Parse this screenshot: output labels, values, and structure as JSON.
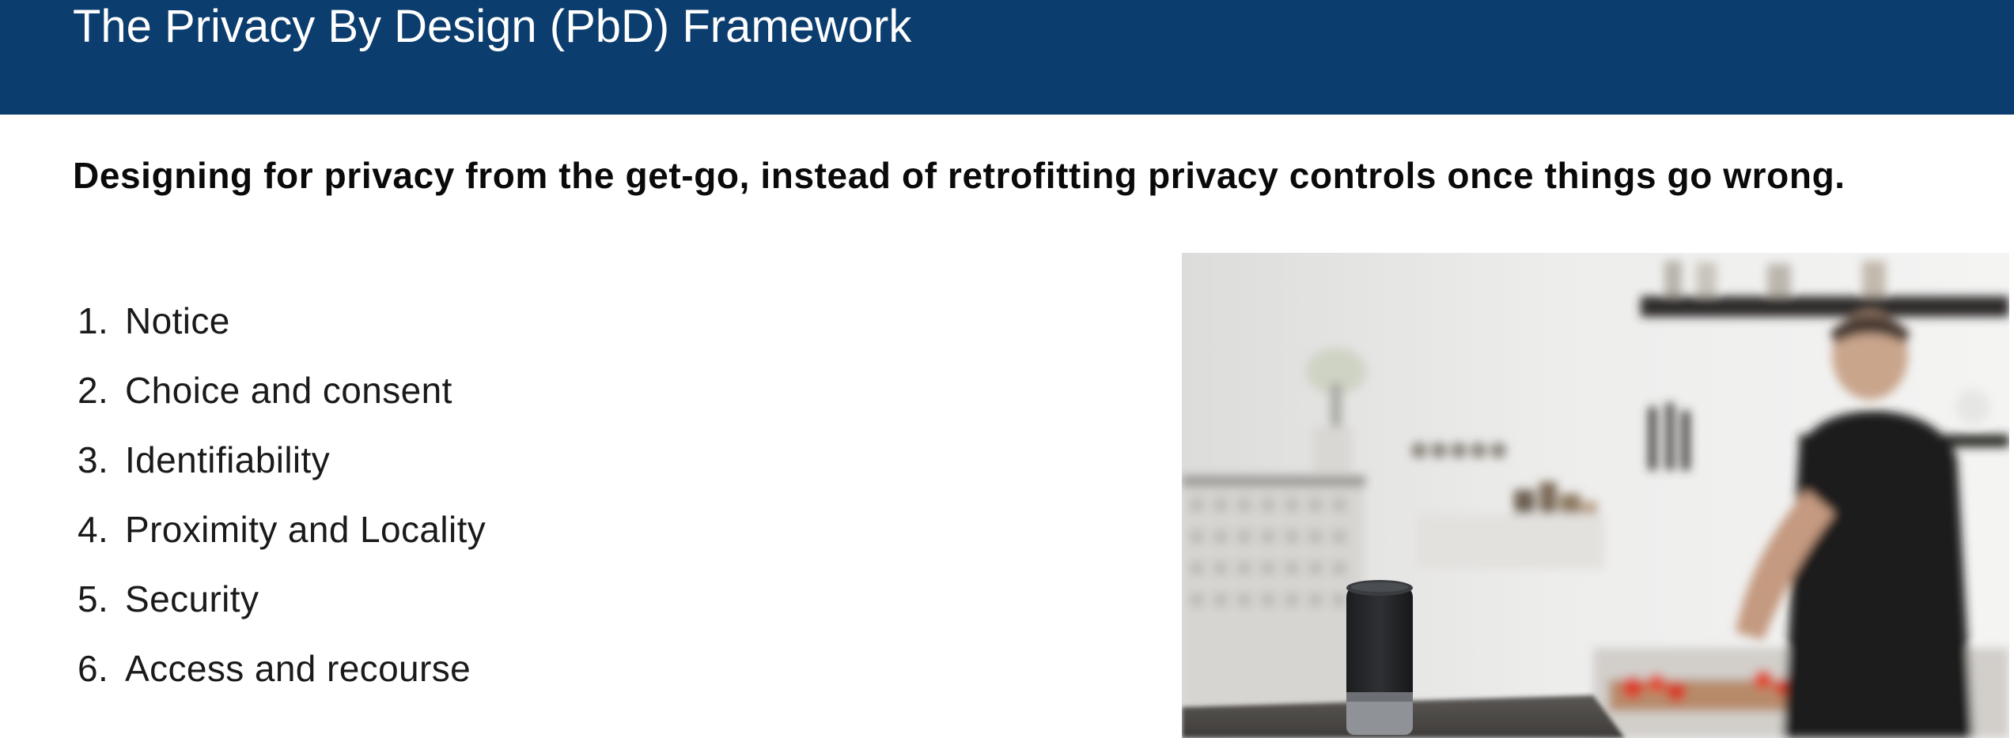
{
  "slide": {
    "title": "The Privacy By Design (PbD) Framework",
    "subtitle": "Designing for privacy from the get-go, instead of retrofitting privacy controls once things go wrong.",
    "principles": [
      {
        "num": "1.",
        "label": "Notice"
      },
      {
        "num": "2.",
        "label": "Choice and consent"
      },
      {
        "num": "3.",
        "label": "Identifiability"
      },
      {
        "num": "4.",
        "label": "Proximity and Locality"
      },
      {
        "num": "5.",
        "label": "Security"
      },
      {
        "num": "6.",
        "label": "Access and recourse"
      }
    ]
  },
  "colors": {
    "title_bar": "#0b3d6e",
    "title_text": "#ffffff",
    "body_text": "#111111"
  }
}
